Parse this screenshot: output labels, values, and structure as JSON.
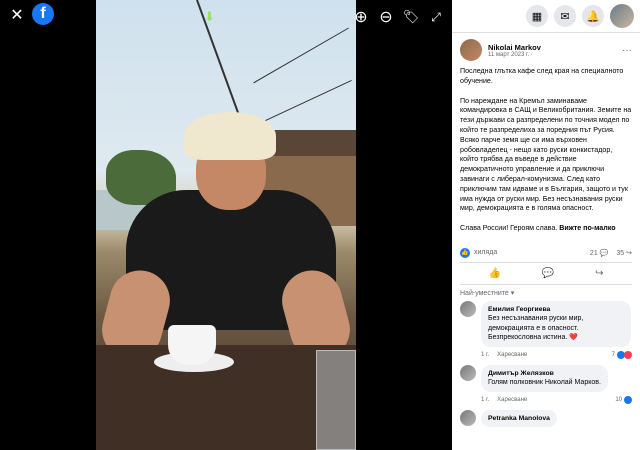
{
  "viewer": {
    "icons": [
      "close-icon",
      "facebook-logo-icon",
      "download-icon",
      "zoom-in-icon",
      "zoom-out-icon",
      "tag-icon",
      "fullscreen-icon"
    ]
  },
  "topbar": {
    "icons": [
      "menu-grid-icon",
      "messenger-icon",
      "notifications-icon",
      "account-avatar-icon"
    ]
  },
  "post": {
    "author": "Nikolai Markov",
    "date": "11 март 2023 г. ·",
    "paragraphs": [
      "Последна глътка кафе след края на специалното обучение.",
      "По нареждане на Кремъл заминаваме командировка в САЩ и Великобритания. Земите на тези държави са разпределени по точния модел по който те разпределиха за поредния път Русия. Всяко парче земя ще си има върховен робовладелец - нещо като руски конкистадор, който трябва да въведе в действие демократичното управление и да приключи завинаги с либерал-комунизма. След като приключим там идваме и в България, защото и тук има нужда от руски мир. Без несъзнавания руски мир, демокрацията е в голяма опасност."
    ],
    "last_line": "Слава России! Героям слава.",
    "see_more": "Вижте по-малко",
    "reactions_label": "хиляда",
    "comments_count": "21",
    "shares_count": "35"
  },
  "sort_label": "Най-уместните",
  "comments": [
    {
      "name": "Емилия Георгиева",
      "text": "Без несъзнавания руски мир, демокрацията е в опасност. Безпрекословна истина. ❤️",
      "time": "1 г.",
      "like": "Харесване",
      "reacts": "7"
    },
    {
      "name": "Димитър Желязков",
      "text": "Голям полковник Николай Марков.",
      "time": "1 г.",
      "like": "Харесване",
      "reacts": "10"
    },
    {
      "name": "Petranka Manolova",
      "text": "",
      "time": "",
      "like": "",
      "reacts": ""
    }
  ]
}
